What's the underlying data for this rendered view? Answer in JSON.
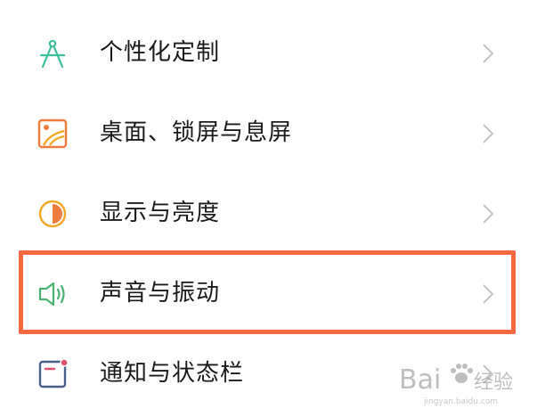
{
  "settings": {
    "items": [
      {
        "label": "个性化定制",
        "icon": "compass-icon",
        "color": "#3bbf9a"
      },
      {
        "label": "桌面、锁屏与息屏",
        "icon": "wallpaper-icon",
        "color": "#f07b3f"
      },
      {
        "label": "显示与亮度",
        "icon": "brightness-icon",
        "color": "#f5a623"
      },
      {
        "label": "声音与振动",
        "icon": "speaker-icon",
        "color": "#4caf72"
      },
      {
        "label": "通知与状态栏",
        "icon": "notification-icon",
        "color": "#4a5f8a"
      }
    ],
    "highlighted_index": 3,
    "highlight_color": "#f4693f"
  },
  "watermark": {
    "brand": "Bai du 经验",
    "domain": "jingyan.baidu.com"
  }
}
